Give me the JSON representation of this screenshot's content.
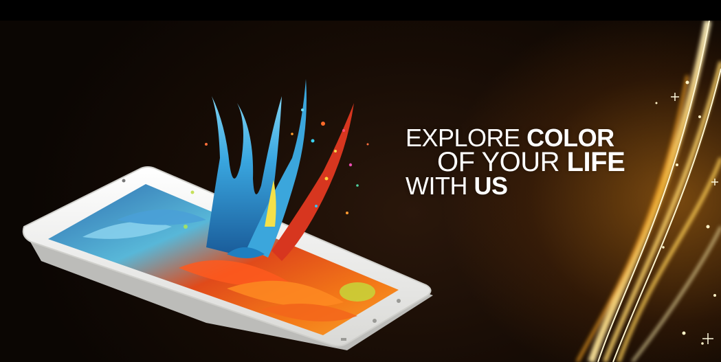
{
  "banner": {
    "headline": {
      "line1_regular": "EXPLORE ",
      "line1_bold": "COLOR",
      "line2_regular": "OF YOUR ",
      "line2_bold": "LIFE",
      "line3_regular": "WITH ",
      "line3_bold": "US"
    },
    "colors": {
      "background": "#120904",
      "gold_light": "#f6c24a",
      "phone_white": "#f4f4f2",
      "text": "#ffffff"
    },
    "icons": [
      "phone-image",
      "paint-splash-image",
      "flower-screen-image",
      "light-streak-decoration"
    ]
  }
}
